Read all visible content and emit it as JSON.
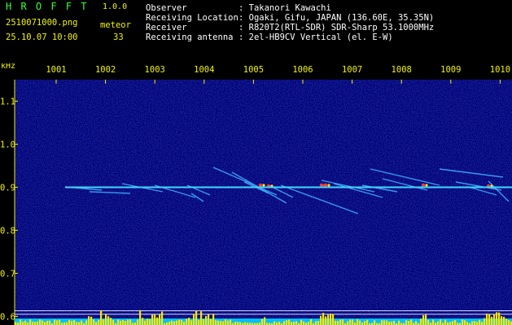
{
  "header": {
    "app_title": "H R O F F T",
    "version": "1.0.0",
    "filename": "2510071000.png",
    "datetime": "25.10.07 10:00",
    "meteor_label": "meteor",
    "meteor_count": "33",
    "info_labels": [
      "Observer",
      "Receiving Location",
      "Receiver",
      "Receiving antenna"
    ],
    "info_values": [
      ": Takanori Kawachi",
      ": Ogaki, Gifu, JAPAN (136.60E, 35.35N)",
      ": R820T2(RTL-SDR) SDR-Sharp 53.1000MHz",
      ": 2el-HB9CV Vertical (el. E-W)"
    ]
  },
  "colors": {
    "header_title": "#39ff39",
    "header_text": "#f3f300",
    "info_text": "#ffffff",
    "axis_text": "#f3f300",
    "background": "#000000",
    "plot_bg": "#00006e",
    "carrier": "#40d8ff",
    "bottom_bar": "#ffe600",
    "bottom_fill": "#00bfff"
  },
  "chart_data": {
    "type": "heatmap",
    "title": "",
    "ylabel": "kHz",
    "x": [
      "1001",
      "1002",
      "1003",
      "1004",
      "1005",
      "1006",
      "1007",
      "1008",
      "1009",
      "1010"
    ],
    "xlabel": "",
    "yticks": [
      "1.1",
      "1.0",
      "0.9",
      "0.8",
      "0.7",
      "0.6"
    ],
    "ylim": [
      0.58,
      1.15
    ],
    "carrier_khz": 0.9,
    "meteor_count": 33
  }
}
